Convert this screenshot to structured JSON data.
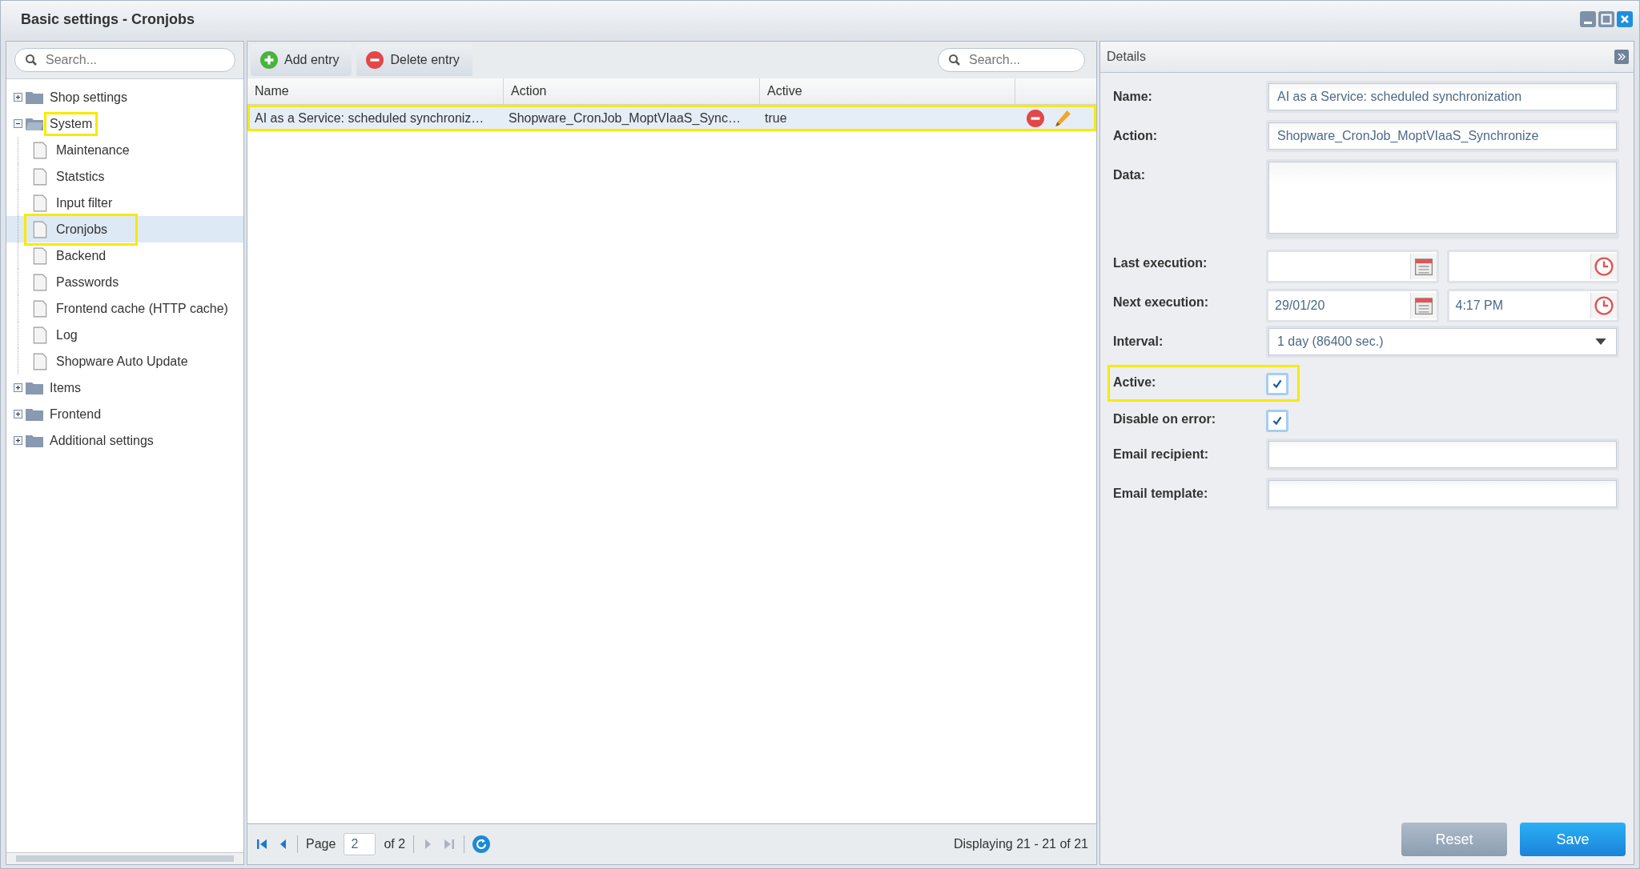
{
  "window": {
    "title": "Basic settings - Cronjobs"
  },
  "sidebar": {
    "search": {
      "placeholder": "Search..."
    },
    "items": [
      {
        "label": "Shop settings",
        "kind": "folder",
        "expanded": false,
        "selected": false,
        "highlighted": false
      },
      {
        "label": "System",
        "kind": "folder",
        "expanded": true,
        "selected": false,
        "highlighted": true,
        "children": [
          {
            "label": "Maintenance",
            "kind": "leaf",
            "selected": false,
            "highlighted": false
          },
          {
            "label": "Statstics",
            "kind": "leaf",
            "selected": false,
            "highlighted": false
          },
          {
            "label": "Input filter",
            "kind": "leaf",
            "selected": false,
            "highlighted": false
          },
          {
            "label": "Cronjobs",
            "kind": "leaf",
            "selected": true,
            "highlighted": true
          },
          {
            "label": "Backend",
            "kind": "leaf",
            "selected": false,
            "highlighted": false
          },
          {
            "label": "Passwords",
            "kind": "leaf",
            "selected": false,
            "highlighted": false
          },
          {
            "label": "Frontend cache (HTTP cache)",
            "kind": "leaf",
            "selected": false,
            "highlighted": false
          },
          {
            "label": "Log",
            "kind": "leaf",
            "selected": false,
            "highlighted": false
          },
          {
            "label": "Shopware Auto Update",
            "kind": "leaf",
            "selected": false,
            "highlighted": false
          }
        ]
      },
      {
        "label": "Items",
        "kind": "folder",
        "expanded": false,
        "selected": false,
        "highlighted": false
      },
      {
        "label": "Frontend",
        "kind": "folder",
        "expanded": false,
        "selected": false,
        "highlighted": false
      },
      {
        "label": "Additional settings",
        "kind": "folder",
        "expanded": false,
        "selected": false,
        "highlighted": false
      }
    ]
  },
  "toolbar": {
    "buttons": [
      {
        "label": "Add entry",
        "kind": "add"
      },
      {
        "label": "Delete entry",
        "kind": "delete"
      }
    ],
    "search": {
      "placeholder": "Search..."
    }
  },
  "table": {
    "columns": [
      "Name",
      "Action",
      "Active"
    ],
    "rows": [
      {
        "cells": [
          "AI as a Service: scheduled synchroniz…",
          "Shopware_CronJob_MoptVIaaS_Sync…",
          "true"
        ],
        "selected": true,
        "highlighted": true
      }
    ]
  },
  "pager": {
    "page_label": "Page",
    "page": "2",
    "of": "of 2",
    "summary": "Displaying 21 - 21 of 21"
  },
  "details": {
    "title": "Details",
    "fields": [
      {
        "label": "Name:",
        "kind": "text",
        "value": "AI as a Service: scheduled synchronization"
      },
      {
        "label": "Action:",
        "kind": "text",
        "value": "Shopware_CronJob_MoptVIaaS_Synchronize"
      },
      {
        "label": "Data:",
        "kind": "textarea"
      },
      {
        "label": "Last execution:",
        "kind": "datetime"
      },
      {
        "label": "Next execution:",
        "kind": "datetime",
        "date": "29/01/20",
        "time": "4:17 PM"
      },
      {
        "label": "Interval:",
        "kind": "combo",
        "value": "1 day (86400 sec.)"
      },
      {
        "label": "Active:",
        "kind": "checkbox",
        "checked": true,
        "highlighted": true
      },
      {
        "label": "Disable on error:",
        "kind": "checkbox",
        "checked": true,
        "highlighted": false
      },
      {
        "label": "Email recipient:",
        "kind": "text"
      },
      {
        "label": "Email template:",
        "kind": "text"
      }
    ],
    "buttons": [
      {
        "label": "Reset",
        "kind": "secondary"
      },
      {
        "label": "Save",
        "kind": "primary"
      }
    ]
  }
}
